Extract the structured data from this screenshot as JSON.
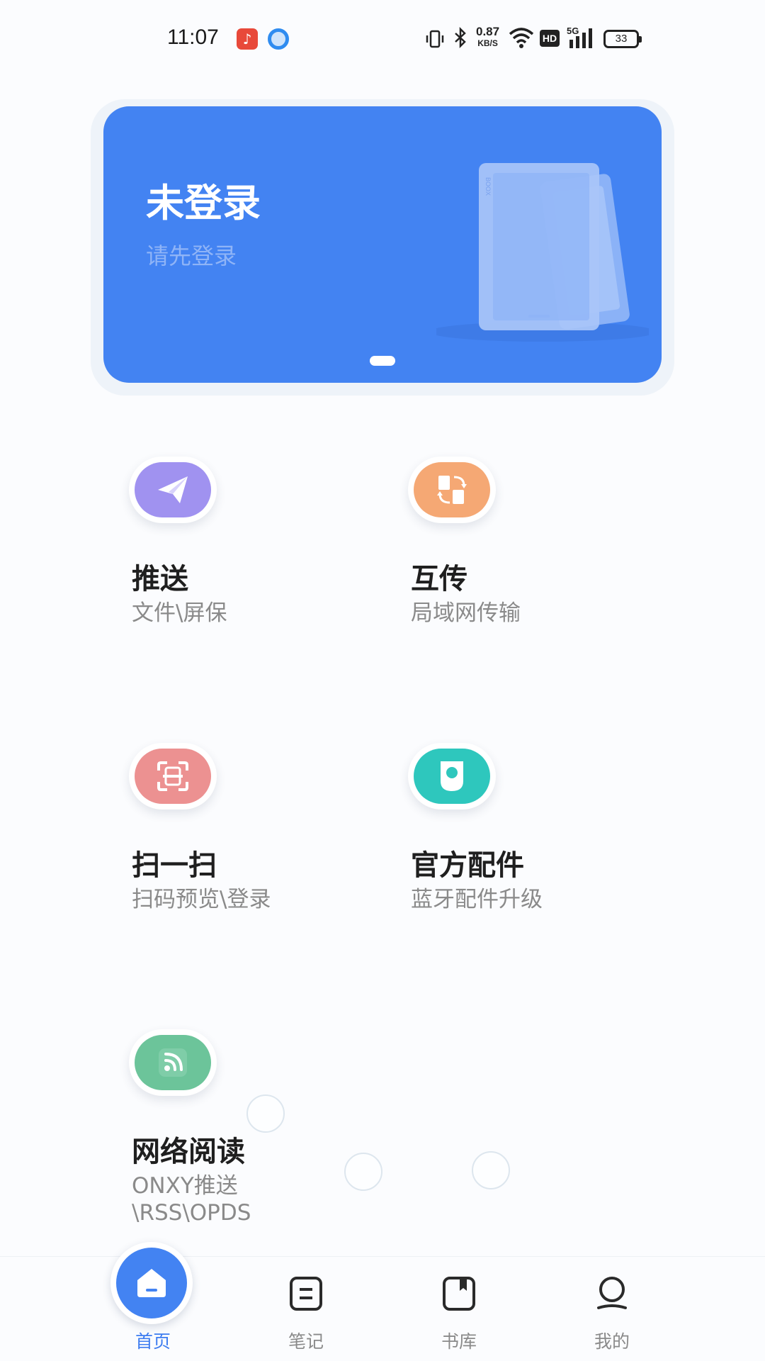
{
  "status_bar": {
    "time": "11:07",
    "speed_value": "0.87",
    "speed_unit": "KB/S",
    "hd": "HD",
    "network": "5G",
    "battery": "33"
  },
  "banner": {
    "title": "未登录",
    "subtitle": "请先登录",
    "device_brand": "BOOX"
  },
  "features": [
    {
      "title": "推送",
      "desc": "文件\\屏保",
      "icon": "paper-plane-icon",
      "color": "#a092f0"
    },
    {
      "title": "互传",
      "desc": "局域网传输",
      "icon": "transfer-icon",
      "color": "#f5a874"
    },
    {
      "title": "扫一扫",
      "desc": "扫码预览\\登录",
      "icon": "scan-icon",
      "color": "#ec9191"
    },
    {
      "title": "官方配件",
      "desc": "蓝牙配件升级",
      "icon": "accessory-icon",
      "color": "#2ec7bd"
    },
    {
      "title": "网络阅读",
      "desc_line1": "ONXY推送",
      "desc_line2": "\\RSS\\OPDS",
      "icon": "rss-icon",
      "color": "#6cc49a"
    }
  ],
  "nav": {
    "items": [
      {
        "label": "首页",
        "icon": "home-icon",
        "active": true
      },
      {
        "label": "笔记",
        "icon": "note-icon",
        "active": false
      },
      {
        "label": "书库",
        "icon": "library-icon",
        "active": false
      },
      {
        "label": "我的",
        "icon": "profile-icon",
        "active": false
      }
    ]
  },
  "colors": {
    "accent": "#4383f2",
    "active_nav": "#3d7cf0"
  }
}
